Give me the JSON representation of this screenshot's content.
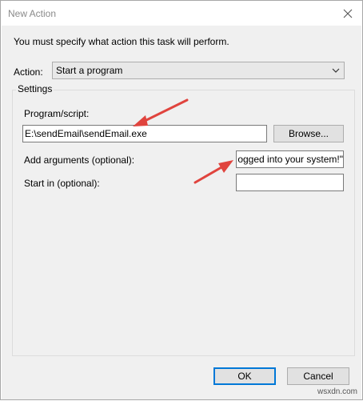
{
  "window": {
    "title": "New Action"
  },
  "instruction": "You must specify what action this task will perform.",
  "action": {
    "label": "Action:",
    "selected": "Start a program"
  },
  "settings": {
    "title": "Settings",
    "program": {
      "label": "Program/script:",
      "value": "E:\\sendEmail\\sendEmail.exe",
      "browse_label": "Browse..."
    },
    "arguments": {
      "label": "Add arguments (optional):",
      "value": "ogged into your system!\""
    },
    "start_in": {
      "label": "Start in (optional):",
      "value": ""
    }
  },
  "buttons": {
    "ok": "OK",
    "cancel": "Cancel"
  },
  "annotation_color": "#e0443e",
  "watermark": "wsxdn.com"
}
